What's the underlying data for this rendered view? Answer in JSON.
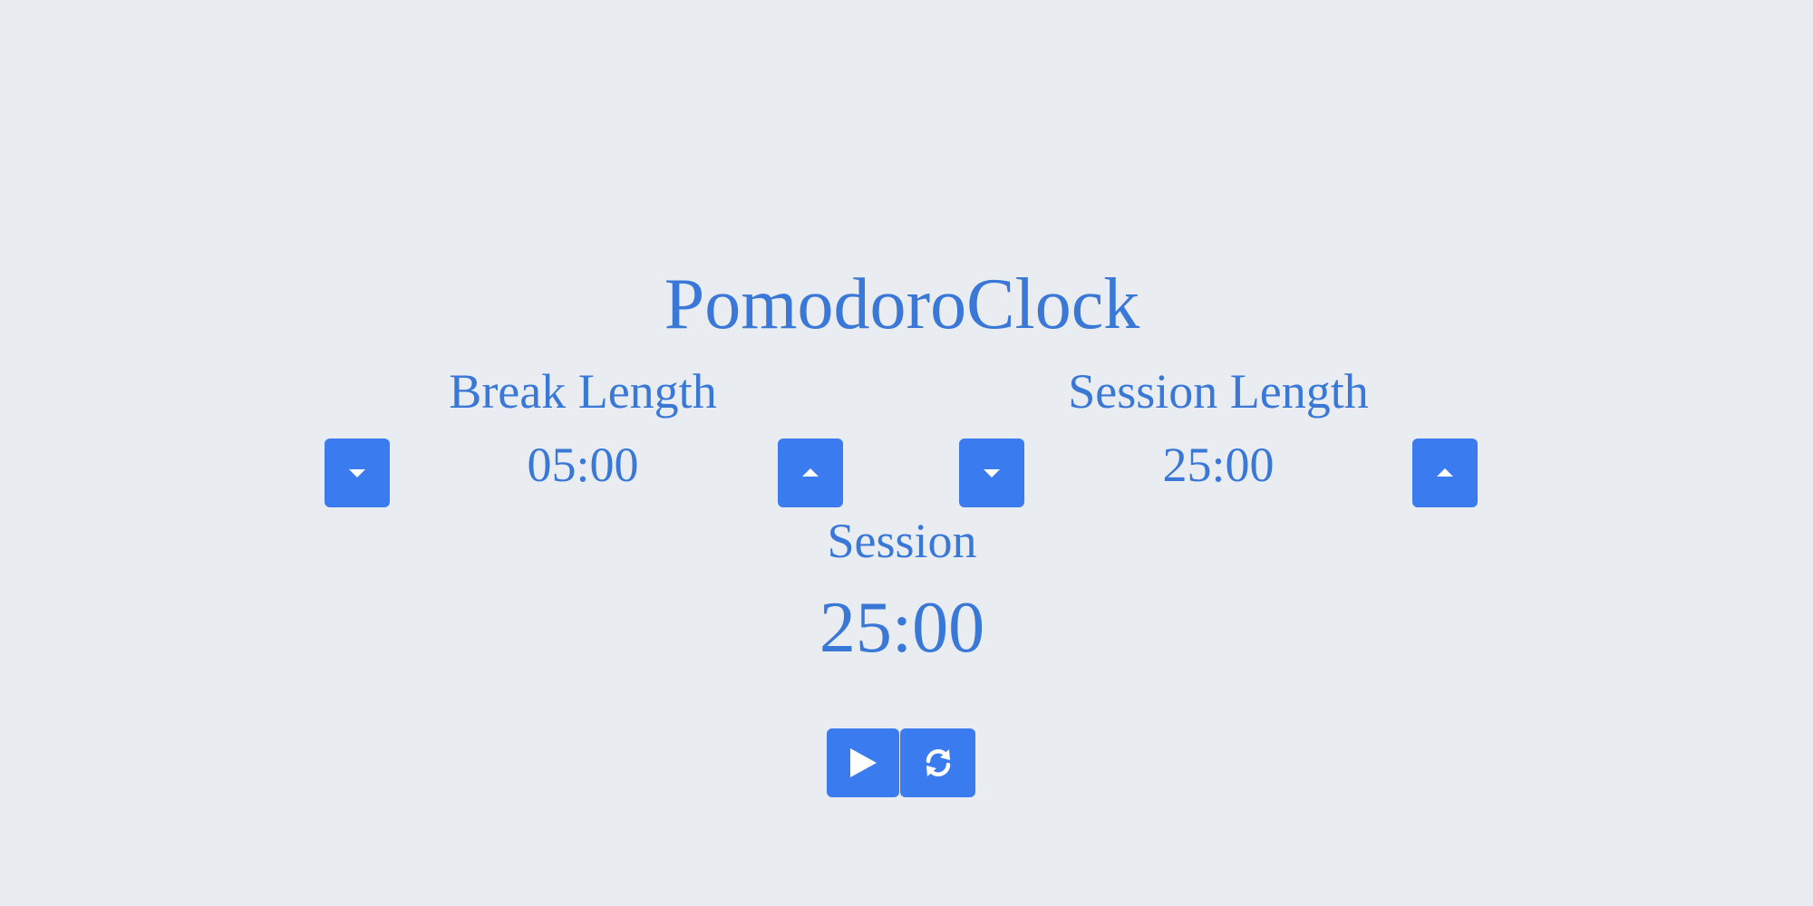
{
  "app": {
    "title": "PomodoroClock"
  },
  "break": {
    "label": "Break Length",
    "value": "05:00",
    "decrement_icon": "caret-down-icon",
    "increment_icon": "caret-up-icon"
  },
  "session": {
    "label": "Session Length",
    "value": "25:00",
    "decrement_icon": "caret-down-icon",
    "increment_icon": "caret-up-icon"
  },
  "timer": {
    "label": "Session",
    "time_left": "25:00"
  },
  "controls": {
    "play_icon": "play-icon",
    "reset_icon": "refresh-icon"
  },
  "colors": {
    "background": "#e9ecf1",
    "text": "#3a78d8",
    "button": "#3a7cf0",
    "icon": "#ffffff"
  }
}
